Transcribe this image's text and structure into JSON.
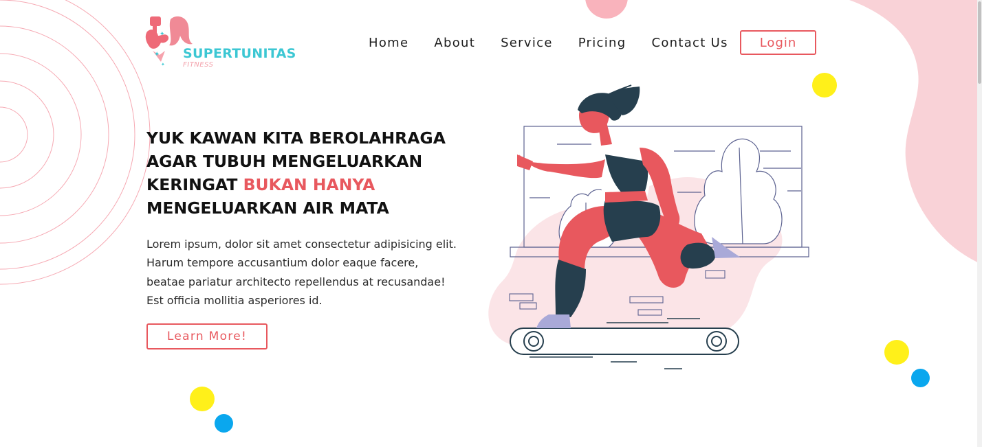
{
  "brand": {
    "name": "SUPERTUNITAS",
    "tagline": "FITNESS",
    "colors": {
      "accent": "#e8585e",
      "teal": "#3cc7d3",
      "pink": "#f9b3bc",
      "yellow": "#fff01a",
      "blue": "#0aa7ee",
      "dark": "#263f4e"
    }
  },
  "nav": {
    "items": [
      {
        "label": "Home"
      },
      {
        "label": "About"
      },
      {
        "label": "Service"
      },
      {
        "label": "Pricing"
      },
      {
        "label": "Contact Us"
      }
    ],
    "login_label": "Login"
  },
  "hero": {
    "headline_part1": "YUK KAWAN KITA BEROLAHRAGA AGAR TUBUH MENGELUARKAN KERINGAT ",
    "headline_accent": "BUKAN HANYA",
    "headline_part2": " MENGELUARKAN AIR MATA",
    "description": "Lorem ipsum, dolor sit amet consectetur adipisicing elit. Harum tempore accusantium dolor eaque facere, beatae pariatur architecto repellendus at recusandae! Est officia mollitia asperiores id.",
    "cta_label": "Learn More!"
  },
  "icons": {
    "logo": "athlete-logo-icon",
    "illustration": "woman-running-treadmill-illustration"
  }
}
